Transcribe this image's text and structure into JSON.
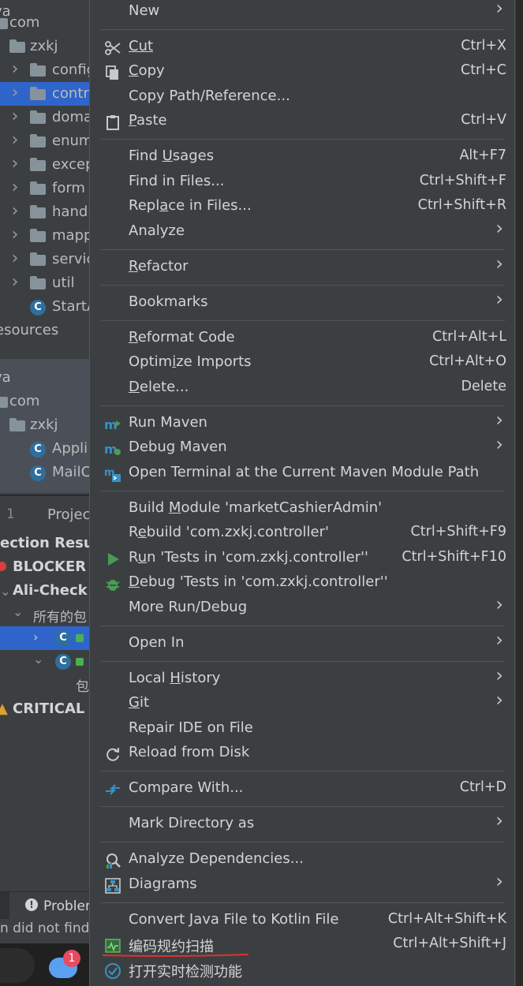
{
  "tree": {
    "rows_top": [
      {
        "text": "va"
      },
      {
        "text": "com"
      },
      {
        "text": "zxkj"
      },
      {
        "text": "config"
      },
      {
        "text": "contr"
      },
      {
        "text": "doma"
      },
      {
        "text": "enum"
      },
      {
        "text": "excep"
      },
      {
        "text": "form"
      },
      {
        "text": "handl"
      },
      {
        "text": "mapp"
      },
      {
        "text": "servic"
      },
      {
        "text": "util"
      },
      {
        "text": "StartA"
      },
      {
        "text": "esources"
      }
    ],
    "rows_bottom": [
      {
        "text": "va"
      },
      {
        "text": "com"
      },
      {
        "text": "zxkj"
      },
      {
        "text": "Appli"
      },
      {
        "text": "MailC"
      }
    ],
    "class_icon_letter": "C"
  },
  "panel": {
    "tab_number": "1",
    "tab_label": "Projec",
    "inspection_header": "ection Result",
    "blocker": "BLOCKER",
    "ali_check": "Ali-Check",
    "all_packages": "所有的包",
    "bao": "包",
    "critical": "CRITICAL",
    "problems_tab": "Problen",
    "status_text": "n did not find",
    "notification_count": "1"
  },
  "menu": {
    "items": [
      {
        "label": "New",
        "shortcut": "",
        "submenu": true
      },
      {
        "label": "Cut",
        "shortcut": "Ctrl+X",
        "icon": "scissors-icon"
      },
      {
        "label": "Copy",
        "shortcut": "Ctrl+C",
        "icon": "copy-icon"
      },
      {
        "label": "Copy Path/Reference...",
        "shortcut": ""
      },
      {
        "label": "Paste",
        "shortcut": "Ctrl+V",
        "icon": "clipboard-icon"
      },
      {
        "label": "Find Usages",
        "shortcut": "Alt+F7"
      },
      {
        "label": "Find in Files...",
        "shortcut": "Ctrl+Shift+F"
      },
      {
        "label": "Replace in Files...",
        "shortcut": "Ctrl+Shift+R"
      },
      {
        "label": "Analyze",
        "submenu": true
      },
      {
        "label": "Refactor",
        "submenu": true
      },
      {
        "label": "Bookmarks",
        "submenu": true
      },
      {
        "label": "Reformat Code",
        "shortcut": "Ctrl+Alt+L"
      },
      {
        "label": "Optimize Imports",
        "shortcut": "Ctrl+Alt+O"
      },
      {
        "label": "Delete...",
        "shortcut": "Delete"
      },
      {
        "label": "Run Maven",
        "submenu": true,
        "icon": "run-maven-icon"
      },
      {
        "label": "Debug Maven",
        "submenu": true,
        "icon": "debug-maven-icon"
      },
      {
        "label": "Open Terminal at the Current Maven Module Path",
        "icon": "maven-terminal-icon"
      },
      {
        "label": "Build Module 'marketCashierAdmin'",
        "shortcut": ""
      },
      {
        "label": "Rebuild 'com.zxkj.controller'",
        "shortcut": "Ctrl+Shift+F9"
      },
      {
        "label": "Run 'Tests in 'com.zxkj.controller''",
        "shortcut": "Ctrl+Shift+F10",
        "icon": "run-icon"
      },
      {
        "label": "Debug 'Tests in 'com.zxkj.controller''",
        "shortcut": "",
        "icon": "debug-bug-icon"
      },
      {
        "label": "More Run/Debug",
        "submenu": true
      },
      {
        "label": "Open In",
        "submenu": true
      },
      {
        "label": "Local History",
        "submenu": true
      },
      {
        "label": "Git",
        "submenu": true
      },
      {
        "label": "Repair IDE on File"
      },
      {
        "label": "Reload from Disk",
        "icon": "reload-icon"
      },
      {
        "label": "Compare With...",
        "shortcut": "Ctrl+D",
        "icon": "compare-icon"
      },
      {
        "label": "Mark Directory as",
        "submenu": true
      },
      {
        "label": "Analyze Dependencies...",
        "icon": "analyze-dependencies-icon"
      },
      {
        "label": "Diagrams",
        "submenu": true,
        "icon": "diagrams-icon"
      },
      {
        "label": "Convert Java File to Kotlin File",
        "shortcut": "Ctrl+Alt+Shift+K"
      },
      {
        "label": "编码规约扫描",
        "shortcut": "Ctrl+Alt+Shift+J",
        "icon": "code-scan-icon"
      },
      {
        "label": "打开实时检测功能",
        "icon": "check-circle-icon"
      }
    ]
  },
  "colors": {
    "menu_bg": "#3c3f41",
    "selection": "#2f65ca",
    "run_green": "#499c54",
    "maven_blue": "#3592c4",
    "red_underline": "#e03030"
  }
}
